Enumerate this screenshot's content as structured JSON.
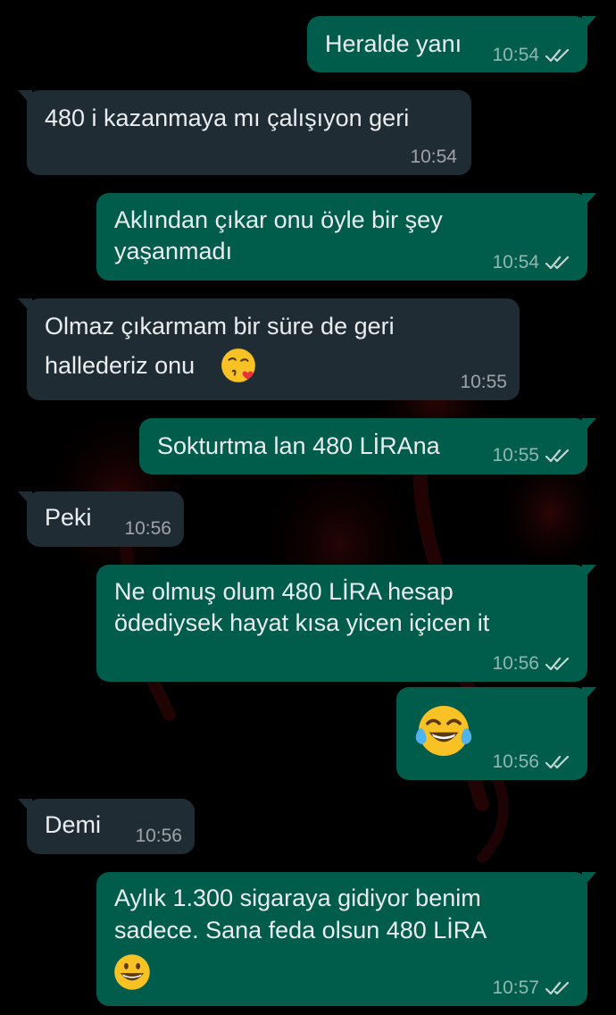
{
  "conversation": {
    "messages": [
      {
        "direction": "outgoing",
        "text": "Heralde yanı",
        "time": "10:54",
        "status": "read"
      },
      {
        "direction": "incoming",
        "text": "480 i kazanmaya mı çalışıyon geri",
        "time": "10:54"
      },
      {
        "direction": "outgoing",
        "lines": [
          "Aklından çıkar onu öyle bir şey",
          "yaşanmadı"
        ],
        "time": "10:54",
        "status": "read"
      },
      {
        "direction": "incoming",
        "lines": [
          "Olmaz çıkarmam bir süre de geri",
          "hallederiz onu"
        ],
        "emoji": "face-blowing-a-kiss",
        "time": "10:55"
      },
      {
        "direction": "outgoing",
        "text": "Sokturtma lan 480 LİRAna",
        "time": "10:55",
        "status": "read"
      },
      {
        "direction": "incoming",
        "text": "Peki",
        "time": "10:56"
      },
      {
        "direction": "outgoing",
        "lines": [
          "Ne olmuş olum 480 LİRA hesap",
          "ödediysek hayat kısa yicen içicen it"
        ],
        "time": "10:56",
        "status": "read"
      },
      {
        "direction": "outgoing",
        "emoji": "face-with-tears-of-joy",
        "time": "10:56",
        "status": "read"
      },
      {
        "direction": "incoming",
        "text": "Demi",
        "time": "10:56"
      },
      {
        "direction": "outgoing",
        "lines": [
          "Aylık 1.300 sigaraya gidiyor benim",
          "sadece. Sana feda olsun 480 LİRA"
        ],
        "emoji": "grinning-face",
        "time": "10:57",
        "status": "read"
      }
    ]
  },
  "colors": {
    "outgoing_bubble": "#005c4b",
    "incoming_bubble": "#202c33",
    "message_text": "#e9edef",
    "read_checks": "#c6d6d2",
    "background": "#000000",
    "wallpaper_accent": "#5a0a0a"
  },
  "icons": {
    "read_receipt": "double-check-icon",
    "wallpaper": "flamingo-silhouettes"
  }
}
